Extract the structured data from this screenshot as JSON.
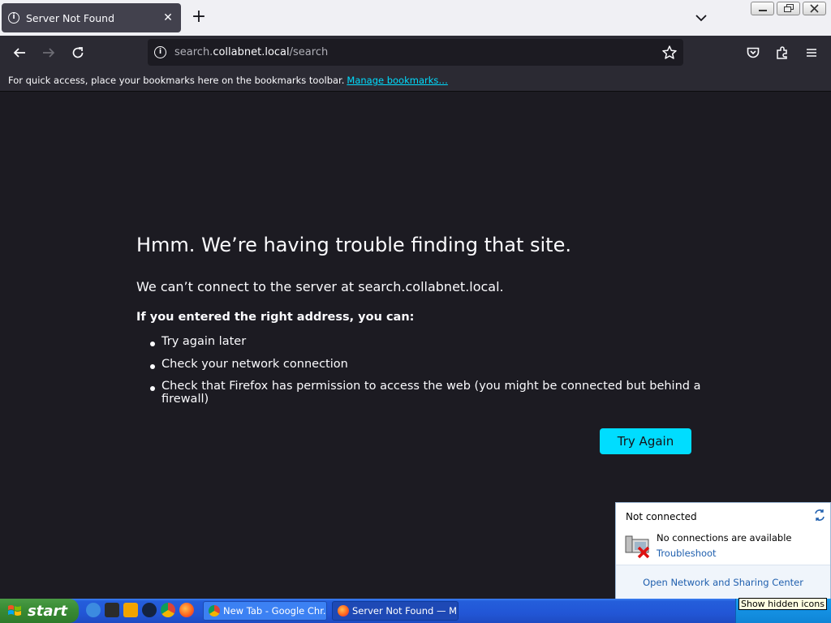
{
  "browser": {
    "tab": {
      "title": "Server Not Found",
      "close": "✕"
    },
    "new_tab": "+",
    "url": {
      "prefix": "search.",
      "host": "collabnet.local",
      "path": "/search"
    },
    "bookmarks_bar": {
      "text": "For quick access, place your bookmarks here on the bookmarks toolbar.",
      "link": "Manage bookmarks…"
    }
  },
  "error_page": {
    "title": "Hmm. We’re having trouble finding that site.",
    "description": "We can’t connect to the server at search.collabnet.local.",
    "subheading": "If you entered the right address, you can:",
    "items": [
      "Try again later",
      "Check your network connection",
      "Check that Firefox has permission to access the web (you might be connected but behind a firewall)"
    ],
    "button": "Try Again"
  },
  "network_popup": {
    "status": "Not connected",
    "message": "No connections are available",
    "troubleshoot": "Troubleshoot",
    "footer_link": "Open Network and Sharing Center"
  },
  "taskbar": {
    "start": "start",
    "tasks": [
      "New Tab - Google Chr...",
      "Server Not Found — M..."
    ],
    "tooltip": "Show hidden icons"
  },
  "colors": {
    "accent": "#00ddff",
    "page_bg": "#1c1b22",
    "toolbar_bg": "#2b2a33",
    "taskbar": "#245edb"
  }
}
